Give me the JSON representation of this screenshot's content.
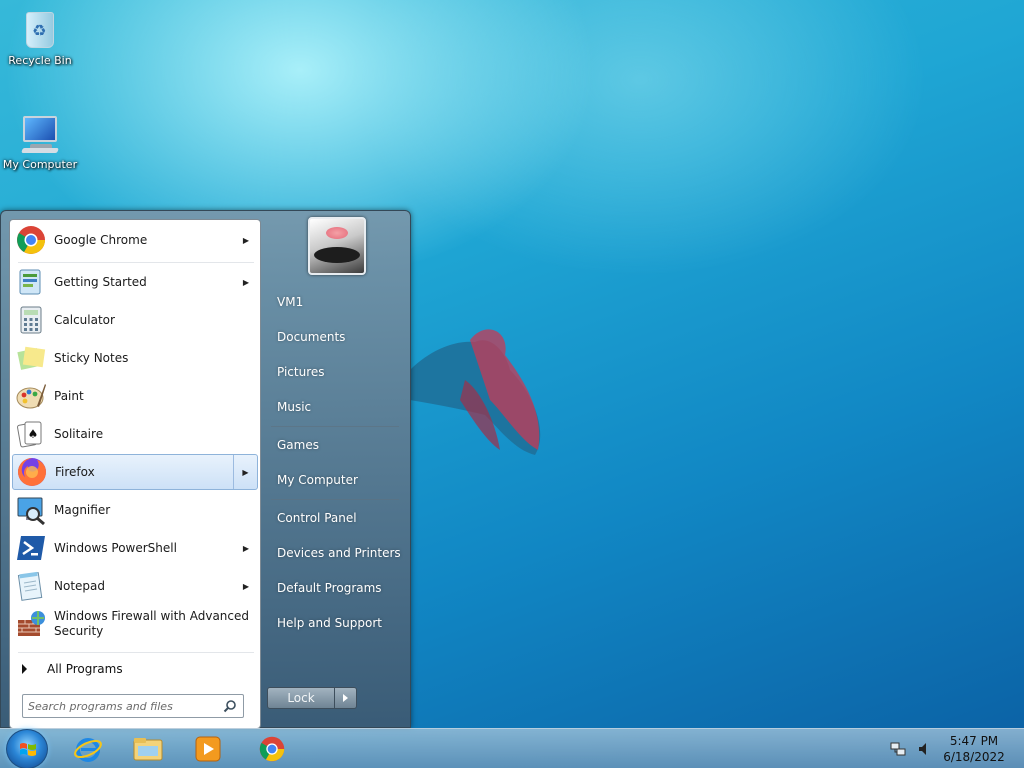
{
  "desktop": {
    "icons": [
      {
        "label": "Recycle Bin",
        "icon": "recycle-bin-icon"
      },
      {
        "label": "My Computer",
        "icon": "computer-icon"
      }
    ]
  },
  "start_menu": {
    "programs": [
      {
        "label": "Google Chrome",
        "icon": "chrome-icon",
        "has_submenu": true
      },
      {
        "label": "Getting Started",
        "icon": "getting-started-icon",
        "has_submenu": true
      },
      {
        "label": "Calculator",
        "icon": "calculator-icon",
        "has_submenu": false
      },
      {
        "label": "Sticky Notes",
        "icon": "sticky-notes-icon",
        "has_submenu": false
      },
      {
        "label": "Paint",
        "icon": "paint-icon",
        "has_submenu": false
      },
      {
        "label": "Solitaire",
        "icon": "solitaire-icon",
        "has_submenu": false
      },
      {
        "label": "Firefox",
        "icon": "firefox-icon",
        "has_submenu": true,
        "highlighted": true
      },
      {
        "label": "Magnifier",
        "icon": "magnifier-icon",
        "has_submenu": false
      },
      {
        "label": "Windows PowerShell",
        "icon": "powershell-icon",
        "has_submenu": true
      },
      {
        "label": "Notepad",
        "icon": "notepad-icon",
        "has_submenu": true
      },
      {
        "label": "Windows Firewall with Advanced Security",
        "icon": "firewall-icon",
        "has_submenu": false
      }
    ],
    "all_programs_label": "All Programs",
    "search_placeholder": "Search programs and files",
    "right_items": [
      "VM1",
      "Documents",
      "Pictures",
      "Music",
      "Games",
      "My Computer",
      "Control Panel",
      "Devices and Printers",
      "Default Programs",
      "Help and Support"
    ],
    "lock_label": "Lock"
  },
  "taskbar": {
    "pinned": [
      "internet-explorer-icon",
      "file-explorer-icon",
      "media-player-icon",
      "chrome-icon"
    ],
    "clock_time": "5:47 PM",
    "clock_date": "6/18/2022"
  }
}
